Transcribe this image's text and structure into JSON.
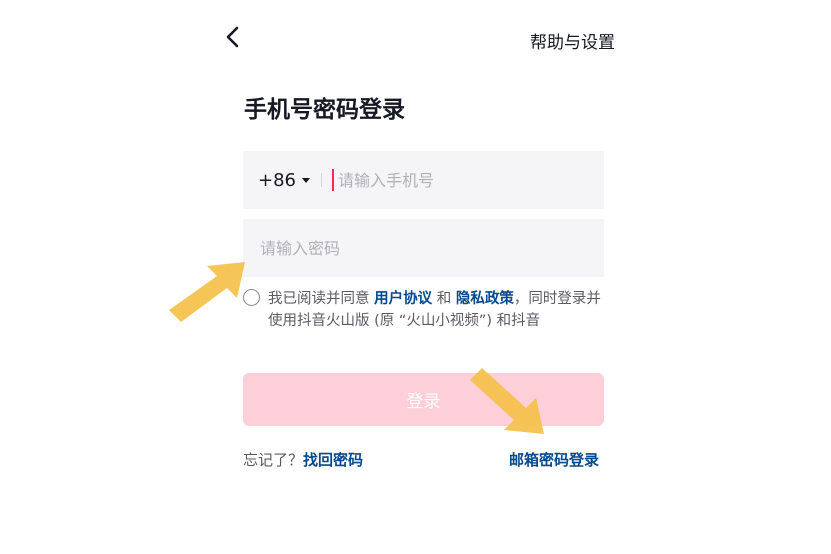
{
  "header": {
    "back_icon": "chevron-left-icon",
    "help_label": "帮助与设置"
  },
  "title": "手机号密码登录",
  "phone": {
    "country_code": "+86",
    "placeholder": "请输入手机号",
    "value": ""
  },
  "password": {
    "placeholder": "请输入密码",
    "value": ""
  },
  "agreement": {
    "checked": false,
    "prefix": "我已阅读并同意 ",
    "user_agreement": "用户协议",
    "and": " 和 ",
    "privacy_policy": "隐私政策",
    "suffix": "，同时登录并使用抖音火山版 (原 “火山小视频”) 和抖音"
  },
  "login_button": "登录",
  "footer": {
    "forgot_prefix": "忘记了？",
    "recover_password": "找回密码",
    "email_login": "邮箱密码登录"
  },
  "colors": {
    "accent": "#fe2c55",
    "login_button_disabled": "#fdcfd8",
    "link": "#04498d",
    "annotation_arrow": "#f5c04a"
  }
}
